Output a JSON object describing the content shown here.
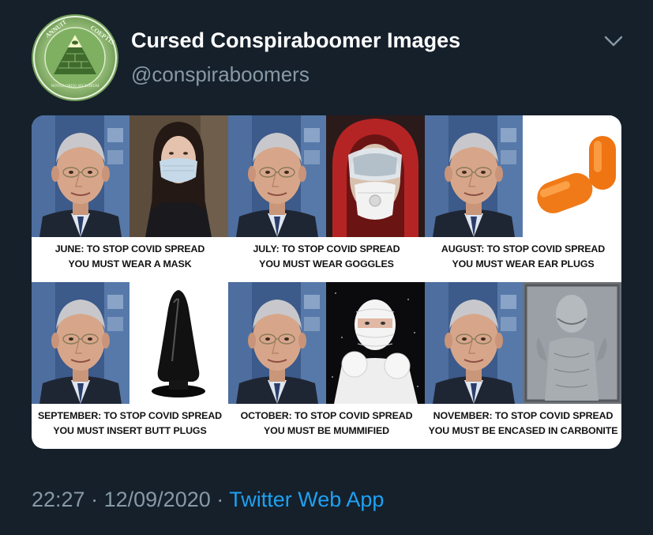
{
  "tweet": {
    "display_name": "Cursed Conspiraboomer Images",
    "handle": "@conspiraboomers",
    "avatar_icon": "illuminati-pyramid-seal",
    "avatar_text": {
      "top_left": "ANNUIT",
      "top_right": "COEPTIS",
      "bottom": "NOVUS ORDO SECLORUM"
    },
    "menu_icon": "chevron-down-icon",
    "time": "22:27",
    "separator": "·",
    "date": "12/09/2020",
    "source": "Twitter Web App"
  },
  "meme": {
    "panels": [
      {
        "line1": "JUNE: TO STOP COVID SPREAD",
        "line2": "YOU MUST WEAR A MASK",
        "item_icon": "face-mask-woman"
      },
      {
        "line1": "JULY: TO STOP COVID SPREAD",
        "line2": "YOU MUST WEAR GOGGLES",
        "item_icon": "goggles-respirator-hood"
      },
      {
        "line1": "AUGUST: TO STOP COVID SPREAD",
        "line2": "YOU MUST WEAR EAR PLUGS",
        "item_icon": "orange-ear-plugs"
      },
      {
        "line1": "SEPTEMBER: TO STOP COVID SPREAD",
        "line2": "YOU MUST INSERT BUTT PLUGS",
        "item_icon": "black-plug"
      },
      {
        "line1": "OCTOBER: TO STOP COVID SPREAD",
        "line2": "YOU MUST BE MUMMIFIED",
        "item_icon": "mummy-wrapped-person"
      },
      {
        "line1": "NOVEMBER: TO STOP COVID SPREAD",
        "line2": "YOU MUST BE ENCASED IN CARBONITE",
        "item_icon": "carbonite-slab"
      }
    ]
  },
  "colors": {
    "background": "#15202b",
    "primary_text": "#ffffff",
    "secondary_text": "#8899a6",
    "link": "#1da1f2"
  }
}
